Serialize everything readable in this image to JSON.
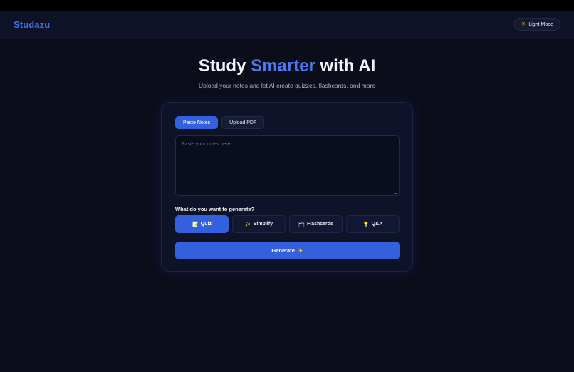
{
  "navbar": {
    "brand": "Studazu",
    "mode_icon": "sun-icon",
    "mode_label": "Light Mode"
  },
  "hero": {
    "title_pre": "Study ",
    "title_accent": "Smarter",
    "title_post": " with AI",
    "subtitle": "Upload your notes and let AI create quizzes, flashcards, and more"
  },
  "tabs": [
    {
      "label": "Paste Notes",
      "active": true
    },
    {
      "label": "Upload PDF",
      "active": false
    }
  ],
  "notes": {
    "placeholder": "Paste your notes here...",
    "value": ""
  },
  "generate_section": {
    "label": "What do you want to generate?",
    "options": [
      {
        "icon": "📝",
        "icon_name": "memo-icon",
        "label": "Quiz",
        "active": true
      },
      {
        "icon": "✨",
        "icon_name": "sparkles-icon",
        "label": "Simplify",
        "active": false
      },
      {
        "icon": "🗂",
        "icon_name": "card-index-icon",
        "label": "Flashcards",
        "active": false
      },
      {
        "icon": "💡",
        "icon_name": "lightbulb-icon",
        "label": "Q&A",
        "active": false
      }
    ],
    "button_label": "Generate",
    "button_icon": "✨",
    "button_icon_name": "sparkles-icon"
  },
  "colors": {
    "accent": "#3460de",
    "brand": "#3f6fe6",
    "background": "#0b0d1b",
    "card": "#0f132a"
  }
}
